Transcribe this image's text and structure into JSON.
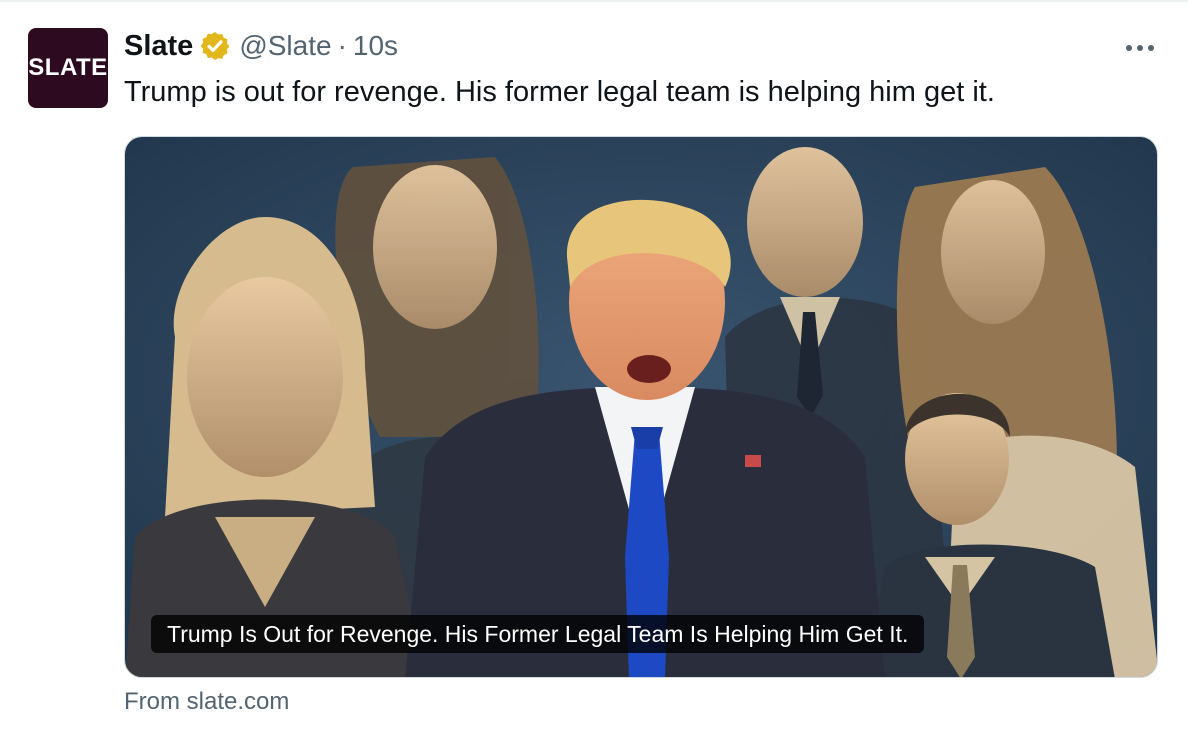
{
  "tweet": {
    "avatar_text": "SLATE",
    "name": "Slate",
    "handle": "@Slate",
    "separator": "·",
    "time": "10s",
    "text": "Trump is out for revenge. His former legal team is helping him get it."
  },
  "card": {
    "headline": "Trump Is Out for Revenge. His Former Legal Team Is Helping Him Get It.",
    "source": "From slate.com"
  },
  "icons": {
    "verified": "verified-badge-icon",
    "more": "more-options-icon"
  },
  "colors": {
    "avatar_bg": "#2e0a20",
    "verified_gold": "#e2b719",
    "secondary_text": "#536471",
    "image_bg": "#243b52",
    "image_tone": "#c9ad83",
    "tie_blue": "#1e49c4"
  }
}
